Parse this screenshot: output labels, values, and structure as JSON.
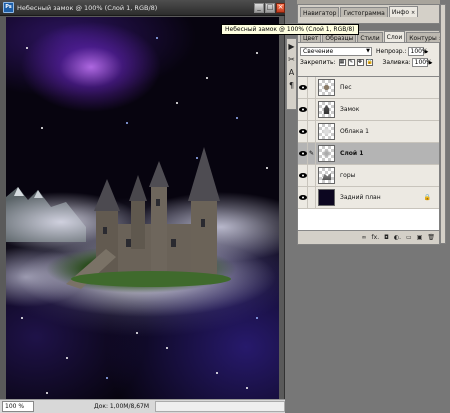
{
  "document": {
    "title": "Небесный замок @ 100% (Слой 1, RGB/8)",
    "zoom": "100 %",
    "doc_info": "Док: 1,00M/8,67M",
    "status_arrow": "▶"
  },
  "tooltip": "Небесный замок @ 100% (Слой 1, RGB/8)",
  "top_panel": {
    "tabs": [
      "Навигатор",
      "Гистограмма",
      "Инфо"
    ],
    "close": "×"
  },
  "layers_panel": {
    "tabs": [
      "Цвет",
      "Образцы",
      "Стили",
      "Слои",
      "Контуры"
    ],
    "close": "×",
    "blend_mode": "Свечение",
    "opacity_label": "Непрозр.:",
    "opacity_value": "100%",
    "lock_label": "Закрепить:",
    "fill_label": "Заливка:",
    "fill_value": "100%",
    "layers": [
      {
        "name": "Пес",
        "selected": false
      },
      {
        "name": "Замок",
        "selected": false
      },
      {
        "name": "Облака 1",
        "selected": false
      },
      {
        "name": "Слой 1",
        "selected": true
      },
      {
        "name": "горы",
        "selected": false
      },
      {
        "name": "Задний план",
        "selected": false
      }
    ],
    "bottom_icons": [
      "∞",
      "fx.",
      "◘",
      "◐.",
      "▭",
      "▣",
      "🗑"
    ]
  },
  "icons": {
    "eye": "eye-icon",
    "lock": "lock-icon",
    "brush": "brush-icon"
  },
  "tool_column": [
    "▶",
    "✂",
    "A",
    "¶"
  ]
}
